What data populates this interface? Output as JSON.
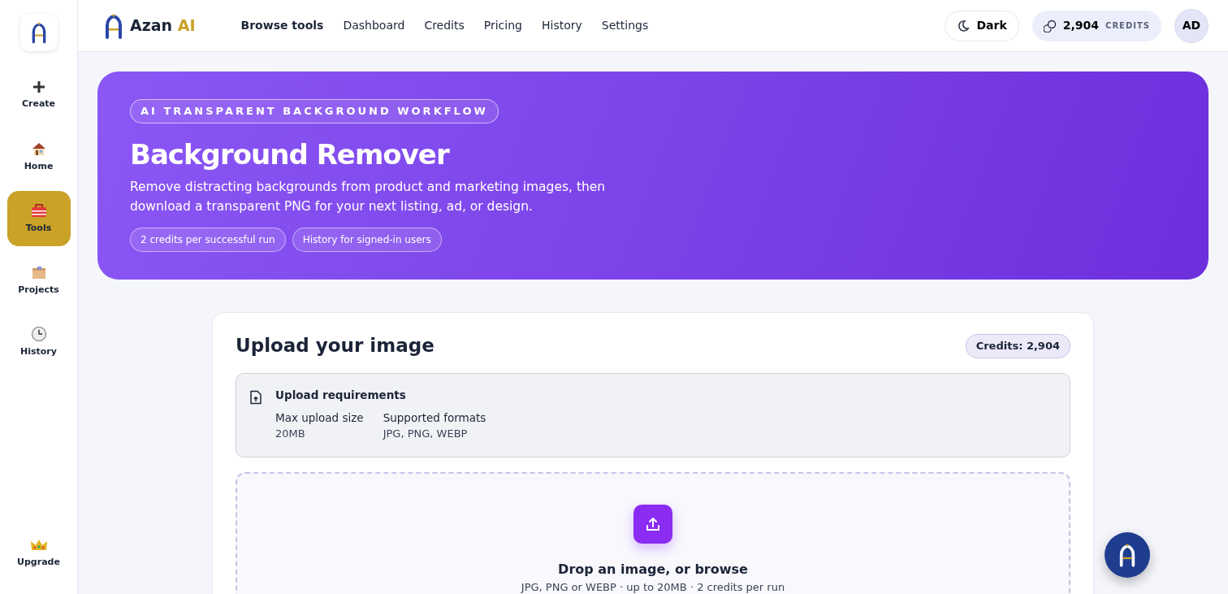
{
  "sidebar": {
    "items": [
      {
        "label": "Create",
        "kind": "plus",
        "selected": false
      },
      {
        "label": "Home",
        "kind": "house",
        "selected": false
      },
      {
        "label": "Tools",
        "kind": "toolbox",
        "selected": true
      },
      {
        "label": "Projects",
        "kind": "box",
        "selected": false
      },
      {
        "label": "History",
        "kind": "clock",
        "selected": false
      }
    ],
    "upgrade": {
      "label": "Upgrade"
    }
  },
  "navbar": {
    "brand": {
      "name": "Azan",
      "accent": "AI"
    },
    "links": [
      {
        "label": "Browse tools",
        "selected": true
      },
      {
        "label": "Dashboard",
        "selected": false
      },
      {
        "label": "Credits",
        "selected": false
      },
      {
        "label": "Pricing",
        "selected": false
      },
      {
        "label": "History",
        "selected": false
      },
      {
        "label": "Settings",
        "selected": false
      }
    ],
    "theme_button": "Dark",
    "credits": {
      "amount": "2,904",
      "unit": "CREDITS"
    },
    "avatar": "AD"
  },
  "hero": {
    "eyebrow": "AI TRANSPARENT BACKGROUND WORKFLOW",
    "title": "Background Remover",
    "description": "Remove distracting backgrounds from product and marketing images, then download a transparent PNG for your next listing, ad, or design.",
    "tags": [
      "2 credits per successful run",
      "History for signed-in users"
    ]
  },
  "upload_card": {
    "title": "Upload your image",
    "credits_badge": "Credits: 2,904",
    "requirements": {
      "title": "Upload requirements",
      "items": [
        {
          "label": "Max upload size",
          "value": "20MB"
        },
        {
          "label": "Supported formats",
          "value": "JPG, PNG, WEBP"
        }
      ]
    },
    "dropzone": {
      "title": "Drop an image, or browse",
      "hint": "JPG, PNG or WEBP · up to 20MB · 2 credits per run"
    }
  }
}
